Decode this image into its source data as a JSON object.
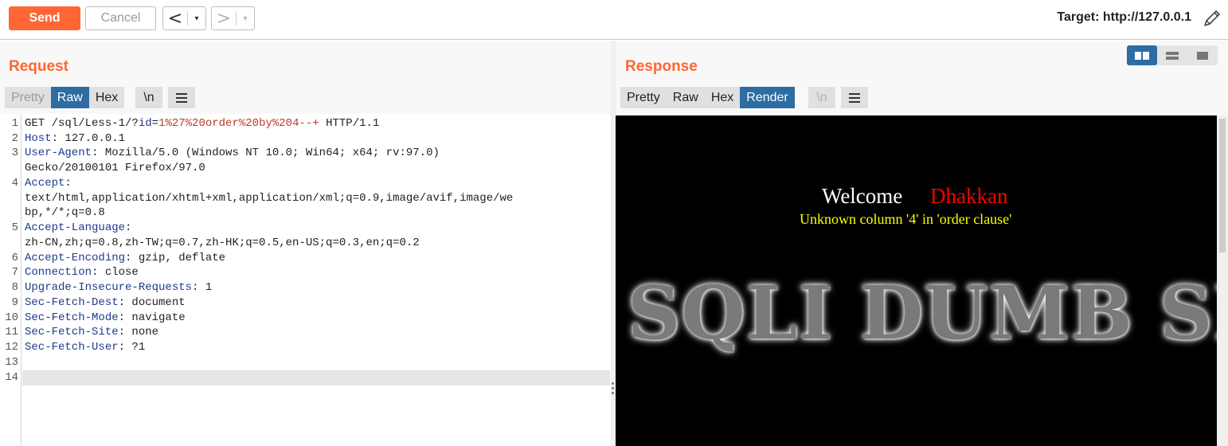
{
  "toolbar": {
    "send_label": "Send",
    "cancel_label": "Cancel",
    "back_icon": "<",
    "forward_icon": ">",
    "dropdown_icon": "▾",
    "target_text": "Target: http://127.0.0.1"
  },
  "request": {
    "title": "Request",
    "tabs": [
      {
        "label": "Pretty",
        "state": "disabled"
      },
      {
        "label": "Raw",
        "state": "active"
      },
      {
        "label": "Hex",
        "state": "normal"
      }
    ],
    "newline_btn": "\\n",
    "line_numbers": [
      "1",
      "2",
      "3",
      "4",
      "5",
      "6",
      "7",
      "8",
      "9",
      "10",
      "11",
      "12",
      "13",
      "14"
    ],
    "lines": {
      "l1_pre": "GET /sql/Less-1/?",
      "l1_param": "id",
      "l1_eq": "=",
      "l1_val": "1%27%20order%20by%204--+",
      "l1_post": " HTTP/1.1",
      "l2_key": "Host",
      "l2_val": ": 127.0.0.1",
      "l3_key": "User-Agent",
      "l3_val": ": Mozilla/5.0 (Windows NT 10.0; Win64; x64; rv:97.0)",
      "l3_cont": "Gecko/20100101 Firefox/97.0",
      "l4_key": "Accept",
      "l4_val": ":",
      "l4_cont1": "text/html,application/xhtml+xml,application/xml;q=0.9,image/avif,image/we",
      "l4_cont2": "bp,*/*;q=0.8",
      "l5_key": "Accept-Language",
      "l5_val": ":",
      "l5_cont": "zh-CN,zh;q=0.8,zh-TW;q=0.7,zh-HK;q=0.5,en-US;q=0.3,en;q=0.2",
      "l6_key": "Accept-Encoding",
      "l6_val": ": gzip, deflate",
      "l7_key": "Connection",
      "l7_val": ": close",
      "l8_key": "Upgrade-Insecure-Requests",
      "l8_val": ": 1",
      "l9_key": "Sec-Fetch-Dest",
      "l9_val": ": document",
      "l10_key": "Sec-Fetch-Mode",
      "l10_val": ": navigate",
      "l11_key": "Sec-Fetch-Site",
      "l11_val": ": none",
      "l12_key": "Sec-Fetch-User",
      "l12_val": ": ?1"
    }
  },
  "response": {
    "title": "Response",
    "tabs": [
      {
        "label": "Pretty",
        "state": "normal"
      },
      {
        "label": "Raw",
        "state": "normal"
      },
      {
        "label": "Hex",
        "state": "normal"
      },
      {
        "label": "Render",
        "state": "active"
      }
    ],
    "newline_btn": "\\n",
    "render": {
      "welcome": "Welcome",
      "name": "Dhakkan",
      "error": "Unknown column '4' in 'order clause'",
      "banner": "SQLI DUMB SERIES"
    }
  },
  "colors": {
    "accent": "#ff6633",
    "active_tab": "#2e6ca4",
    "render_bg": "#000000",
    "error_text": "#ffff00",
    "name_text": "#ff0000"
  }
}
